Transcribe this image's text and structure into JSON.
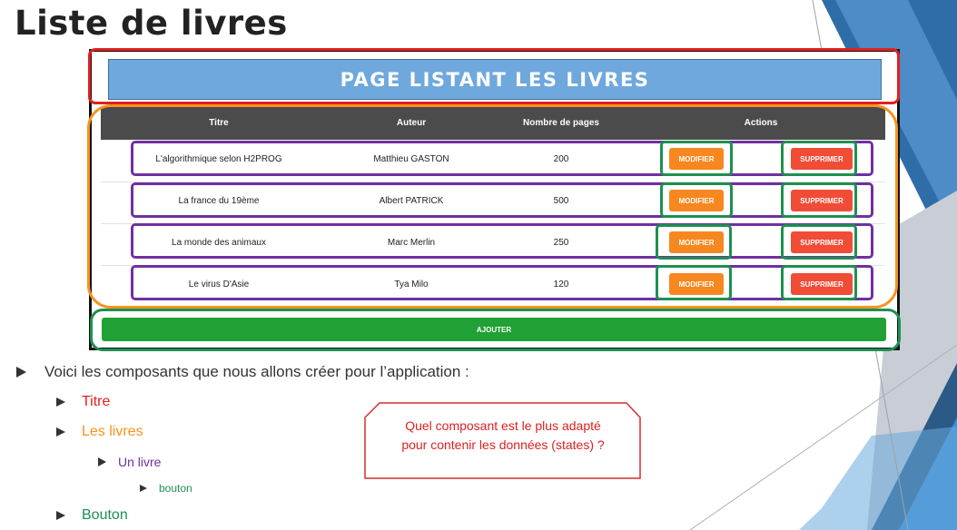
{
  "slide_title": "Liste de livres",
  "app": {
    "header_title": "Page listant les livres",
    "columns": [
      "Titre",
      "Auteur",
      "Nombre de pages",
      "Actions"
    ],
    "books": [
      {
        "titre": "L'algorithmique selon H2PROG",
        "auteur": "Matthieu GASTON",
        "pages": "200"
      },
      {
        "titre": "La france du 19ème",
        "auteur": "Albert PATRICK",
        "pages": "500"
      },
      {
        "titre": "La monde des animaux",
        "auteur": "Marc Merlin",
        "pages": "250"
      },
      {
        "titre": "Le virus D'Asie",
        "auteur": "Tya Milo",
        "pages": "120"
      }
    ],
    "modify_label": "MODIFIER",
    "delete_label": "SUPPRIMER",
    "add_label": "AJOUTER"
  },
  "bullets": {
    "intro": "Voici les composants que nous allons créer pour l’application :",
    "titre": "Titre",
    "les_livres": "Les livres",
    "un_livre": "Un livre",
    "bouton_small": "bouton",
    "bouton": "Bouton"
  },
  "callout": {
    "line1": "Quel composant est le plus adapté",
    "line2": "pour contenir les données (states) ?"
  },
  "colors": {
    "title_highlight": "#e02020",
    "list_highlight": "#f7931e",
    "item_highlight": "#7030a0",
    "button_highlight": "#1e9050",
    "modify_button": "#f7871f",
    "delete_button": "#f04c36",
    "add_button": "#21a035",
    "header_blue": "#6fa8dc"
  }
}
